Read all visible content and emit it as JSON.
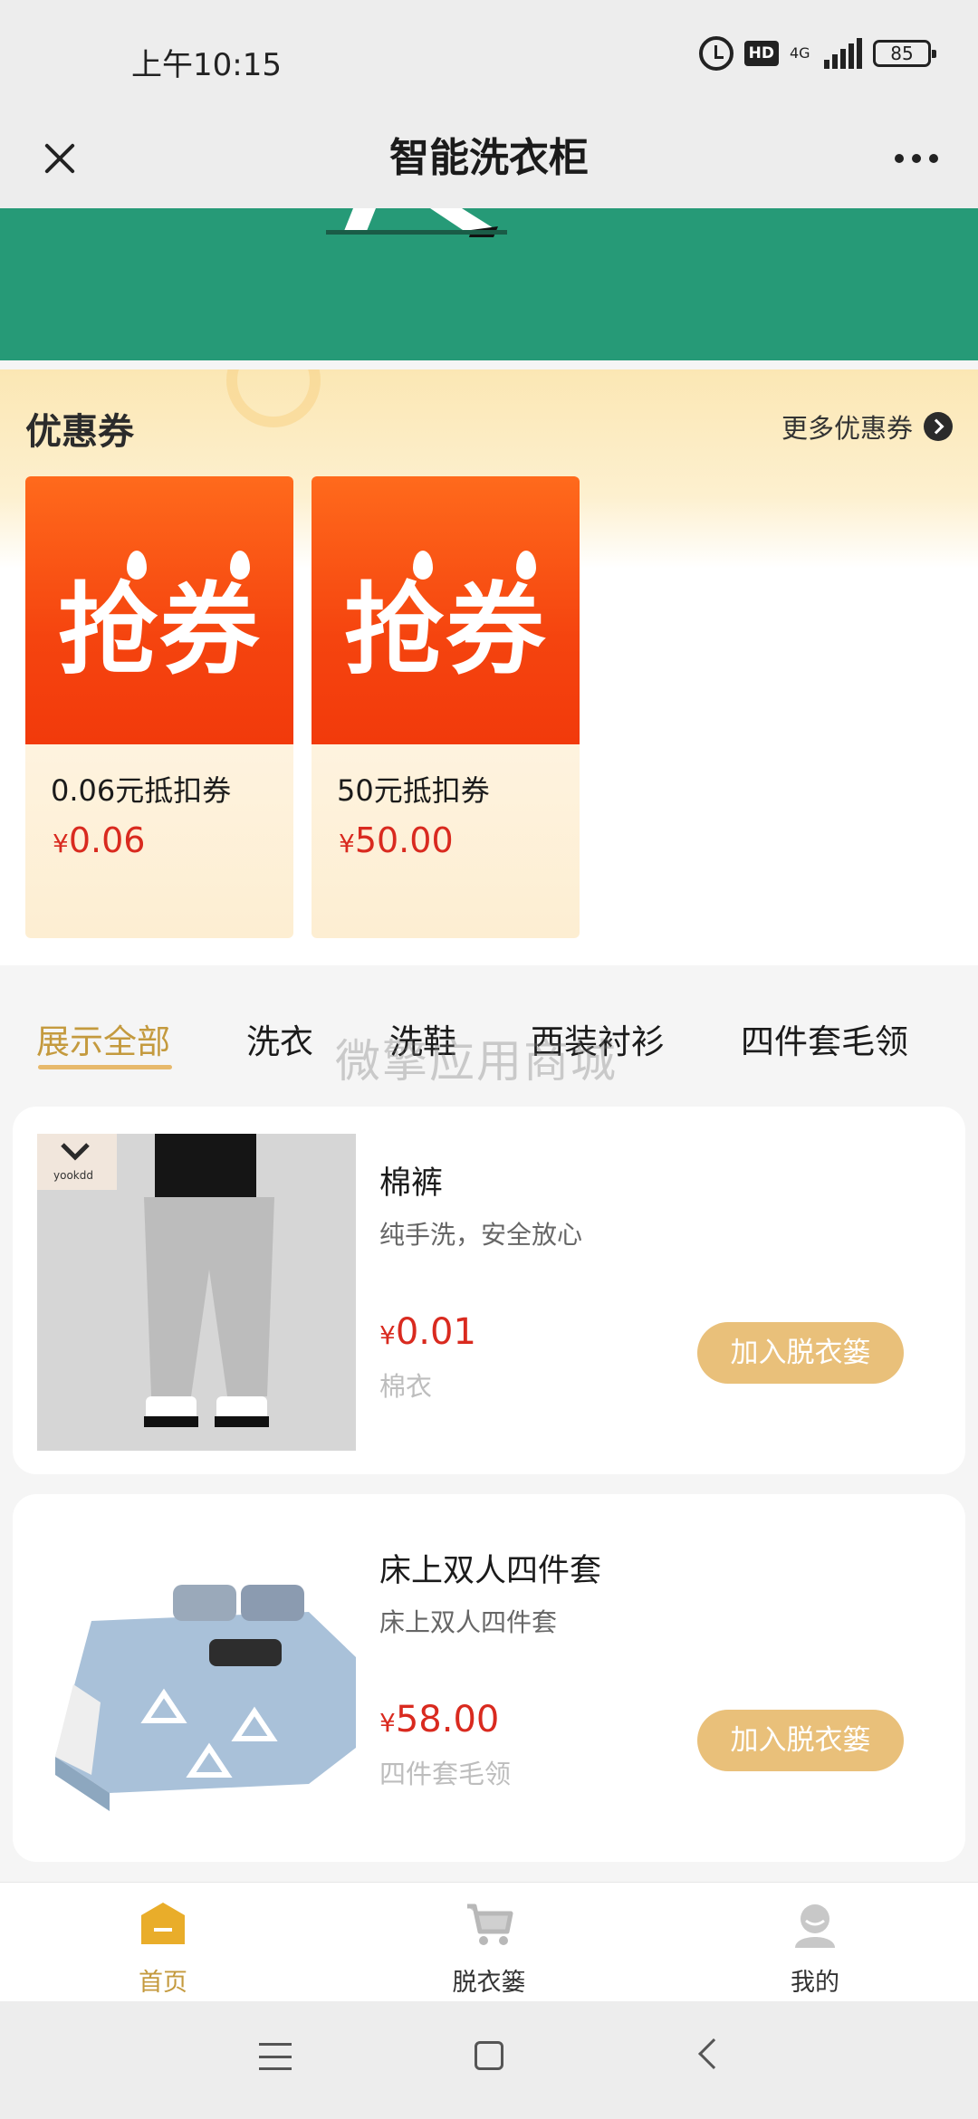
{
  "status_bar": {
    "time": "上午10:15",
    "hd_label": "HD",
    "network": "4G",
    "battery": "85"
  },
  "header": {
    "title": "智能洗衣柜"
  },
  "coupons": {
    "section_title": "优惠券",
    "more_label": "更多优惠券",
    "items": [
      {
        "image_text": "抢券",
        "name": "0.06元抵扣券",
        "currency": "¥",
        "price": "0.06"
      },
      {
        "image_text": "抢券",
        "name": "50元抵扣券",
        "currency": "¥",
        "price": "50.00"
      }
    ]
  },
  "category_tabs": [
    {
      "label": "展示全部",
      "active": true
    },
    {
      "label": "洗衣",
      "active": false
    },
    {
      "label": "洗鞋",
      "active": false
    },
    {
      "label": "西装衬衫",
      "active": false
    },
    {
      "label": "四件套毛领",
      "active": false
    }
  ],
  "watermark": "微擎应用商城",
  "products": [
    {
      "name": "棉裤",
      "description": "纯手洗，安全放心",
      "currency": "¥",
      "price": "0.01",
      "category": "棉衣",
      "button_label": "加入脱衣篓",
      "brand_text": "yookdd"
    },
    {
      "name": "床上双人四件套",
      "description": "床上双人四件套",
      "currency": "¥",
      "price": "58.00",
      "category": "四件套毛领",
      "button_label": "加入脱衣篓"
    }
  ],
  "tabbar": [
    {
      "label": "首页",
      "icon": "home-icon",
      "active": true
    },
    {
      "label": "脱衣篓",
      "icon": "cart-icon",
      "active": false
    },
    {
      "label": "我的",
      "icon": "user-icon",
      "active": false
    }
  ],
  "colors": {
    "accent": "#c49a3e",
    "button": "#e9c07a",
    "price": "#d92a1f",
    "banner": "#269a77",
    "coupon_red": "#f5440f"
  }
}
